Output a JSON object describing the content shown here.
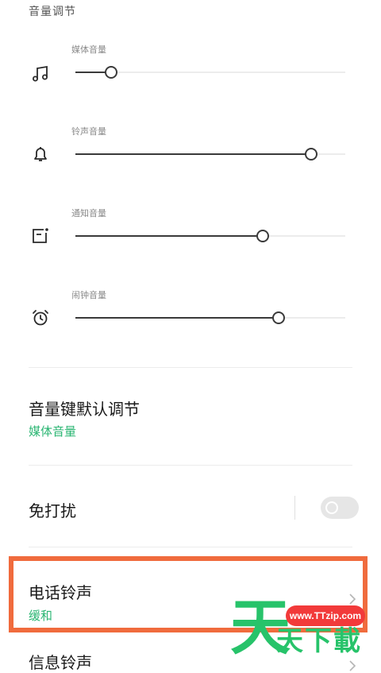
{
  "section": {
    "title": "音量调节"
  },
  "sliders": [
    {
      "label": "媒体音量",
      "icon": "music-note-icon",
      "level": 0.13
    },
    {
      "label": "铃声音量",
      "icon": "bell-icon",
      "level": 0.87
    },
    {
      "label": "通知音量",
      "icon": "notification-icon",
      "level": 0.69
    },
    {
      "label": "闹钟音量",
      "icon": "alarm-clock-icon",
      "level": 0.75
    }
  ],
  "volume_key": {
    "title": "音量键默认调节",
    "value": "媒体音量"
  },
  "dnd": {
    "title": "免打扰",
    "enabled": false
  },
  "ringtone": {
    "title": "电话铃声",
    "value": "缓和"
  },
  "message_tone": {
    "title": "信息铃声"
  },
  "watermark": {
    "url": "www.TTzip.com",
    "big": "天",
    "text": "天下載"
  },
  "colors": {
    "accent": "#2bb673",
    "highlight": "#f06b3d",
    "watermark_green": "#27c36a",
    "watermark_red": "#f23a3a"
  }
}
